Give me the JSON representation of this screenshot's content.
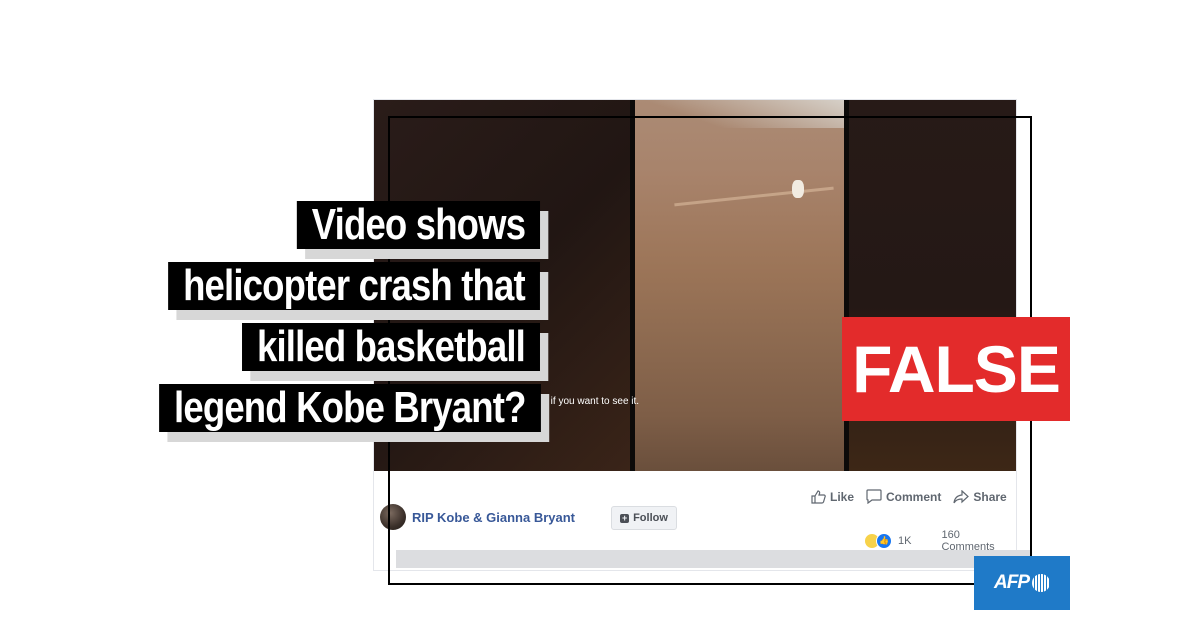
{
  "headline": {
    "lines": [
      "Video shows",
      "helicopter crash that",
      "killed basketball",
      "legend Kobe Bryant?"
    ]
  },
  "stamp": {
    "label": "FALSE",
    "color": "#e32b2b"
  },
  "post": {
    "video_caption": "ecide if you want to see it.",
    "page_name": "RIP Kobe & Gianna Bryant",
    "follow_label": "Follow",
    "actions": {
      "like": "Like",
      "comment": "Comment",
      "share": "Share"
    },
    "reaction_count": "1K",
    "comment_count": "160 Comments",
    "reaction_icons": [
      "sad-emoji",
      "like-emoji"
    ]
  },
  "logo": {
    "text": "AFP",
    "color": "#1f7ac8"
  }
}
